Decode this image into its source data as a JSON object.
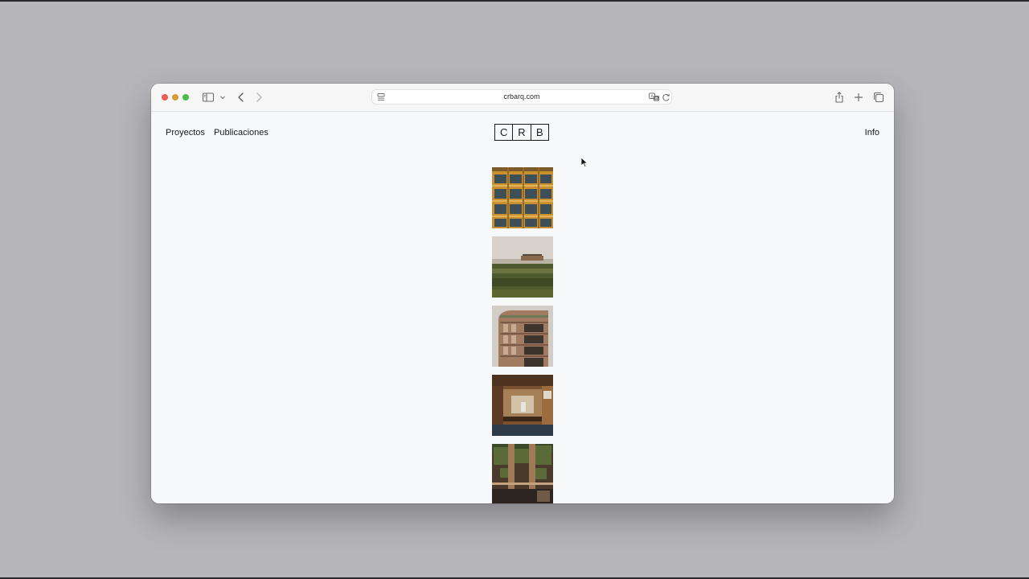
{
  "browser": {
    "url": "crbarq.com",
    "icons": [
      "sidebar-icon",
      "chevron-down-icon",
      "back-icon",
      "forward-icon",
      "page-icon",
      "translate-icon",
      "reload-icon",
      "share-icon",
      "new-tab-icon",
      "tabs-overview-icon"
    ]
  },
  "site": {
    "nav": {
      "projects": "Proyectos",
      "publications": "Publicaciones",
      "info": "Info"
    },
    "logo": [
      "C",
      "R",
      "B"
    ],
    "projects": [
      {
        "image": "facade-balconies-photo"
      },
      {
        "image": "landscape-house-photo"
      },
      {
        "image": "rounded-building-photo"
      },
      {
        "image": "wood-interior-photo"
      },
      {
        "image": "green-facade-photo"
      }
    ]
  },
  "colors": {
    "desktop": "#b6b6ba",
    "page_background": "#f6f8fa",
    "text": "#1b1b1b"
  }
}
